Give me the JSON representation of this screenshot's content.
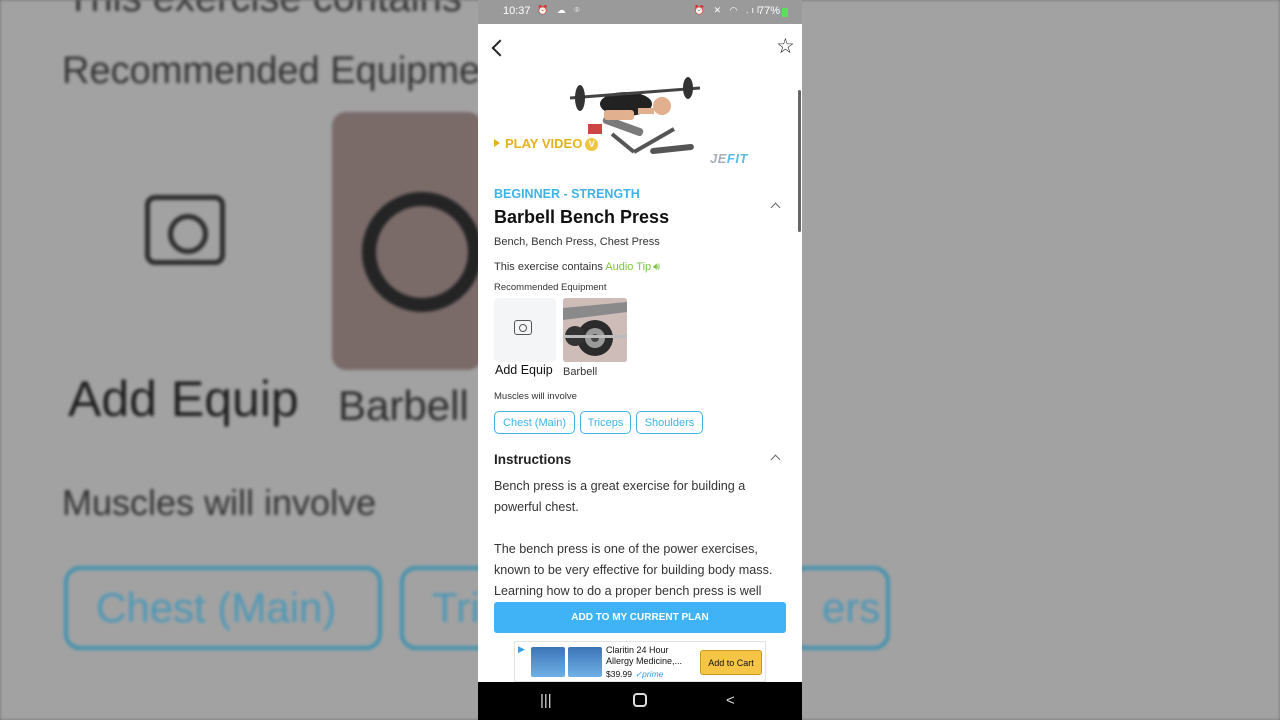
{
  "status_bar": {
    "time": "10:37",
    "left_icons": "⏰ ☁ ⌾",
    "right_icons": "⏰ ✕ ◠ .ıl",
    "battery": "77%"
  },
  "header": {
    "back_icon": "back-arrow-icon",
    "favorite_icon": "star-outline-icon"
  },
  "video": {
    "play_label": "PLAY VIDEO",
    "badge": "V",
    "brand_prefix": "JE",
    "brand_suffix": "FIT"
  },
  "exercise": {
    "level": "BEGINNER - STRENGTH",
    "name": "Barbell Bench Press",
    "aliases": "Bench, Bench Press, Chest Press",
    "contains_text": "This exercise contains",
    "audio_tip": "Audio Tip"
  },
  "equipment": {
    "heading": "Recommended Equipment",
    "add_label": "Add Equip",
    "items": [
      {
        "label": "Barbell"
      }
    ]
  },
  "muscles": {
    "heading": "Muscles will involve",
    "chips": [
      "Chest (Main)",
      "Triceps",
      "Shoulders"
    ]
  },
  "instructions": {
    "heading": "Instructions",
    "paragraphs": [
      "Bench press is a great exercise for building a powerful chest.",
      "The bench press is one of the power exercises, known to be very effective for building body mass. Learning how to do a proper bench press is well"
    ]
  },
  "cta": {
    "label": "ADD TO MY CURRENT PLAN"
  },
  "ad": {
    "title": "Claritin 24 Hour Allergy Medicine,...",
    "price": "$39.99",
    "prime": "✓prime",
    "button": "Add to Cart"
  },
  "background": {
    "line1": "This exercise contains",
    "line2": "Recommended Equipme",
    "add_equip": "Add Equip",
    "barbell": "Barbell",
    "muscles": "Muscles will involve",
    "chip1": "Chest (Main)",
    "chip2": "Tri",
    "chip3": "ers"
  },
  "colors": {
    "accent": "#3fb3e6",
    "audio_tip": "#7cc444",
    "play": "#e5b21b",
    "cta": "#3fb3f5"
  }
}
